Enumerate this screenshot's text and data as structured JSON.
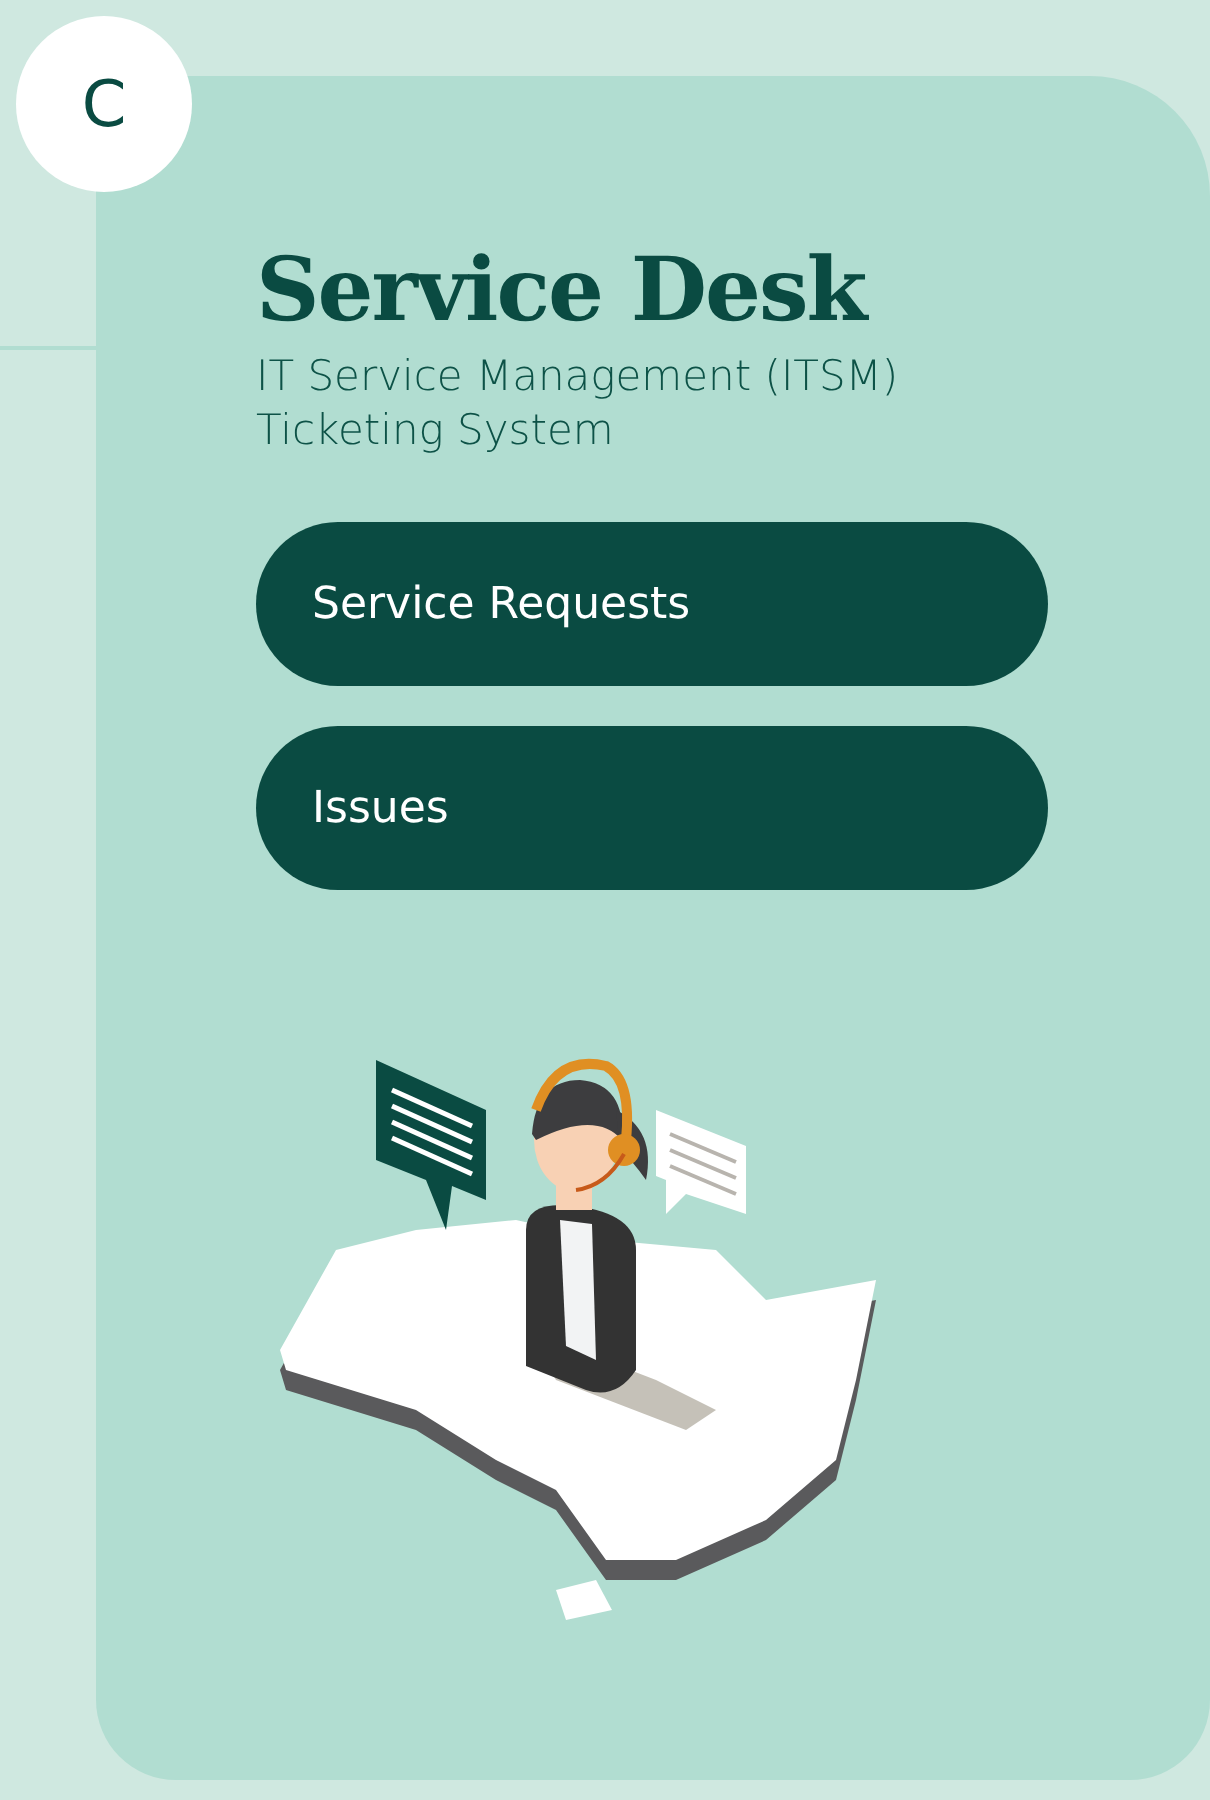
{
  "avatar": {
    "letter": "C"
  },
  "title": "Service Desk",
  "subtitle_lines": [
    "IT Service Management (ITSM)",
    "Ticketing System"
  ],
  "buttons": [
    {
      "label": "Service Requests"
    },
    {
      "label": "Issues"
    }
  ]
}
